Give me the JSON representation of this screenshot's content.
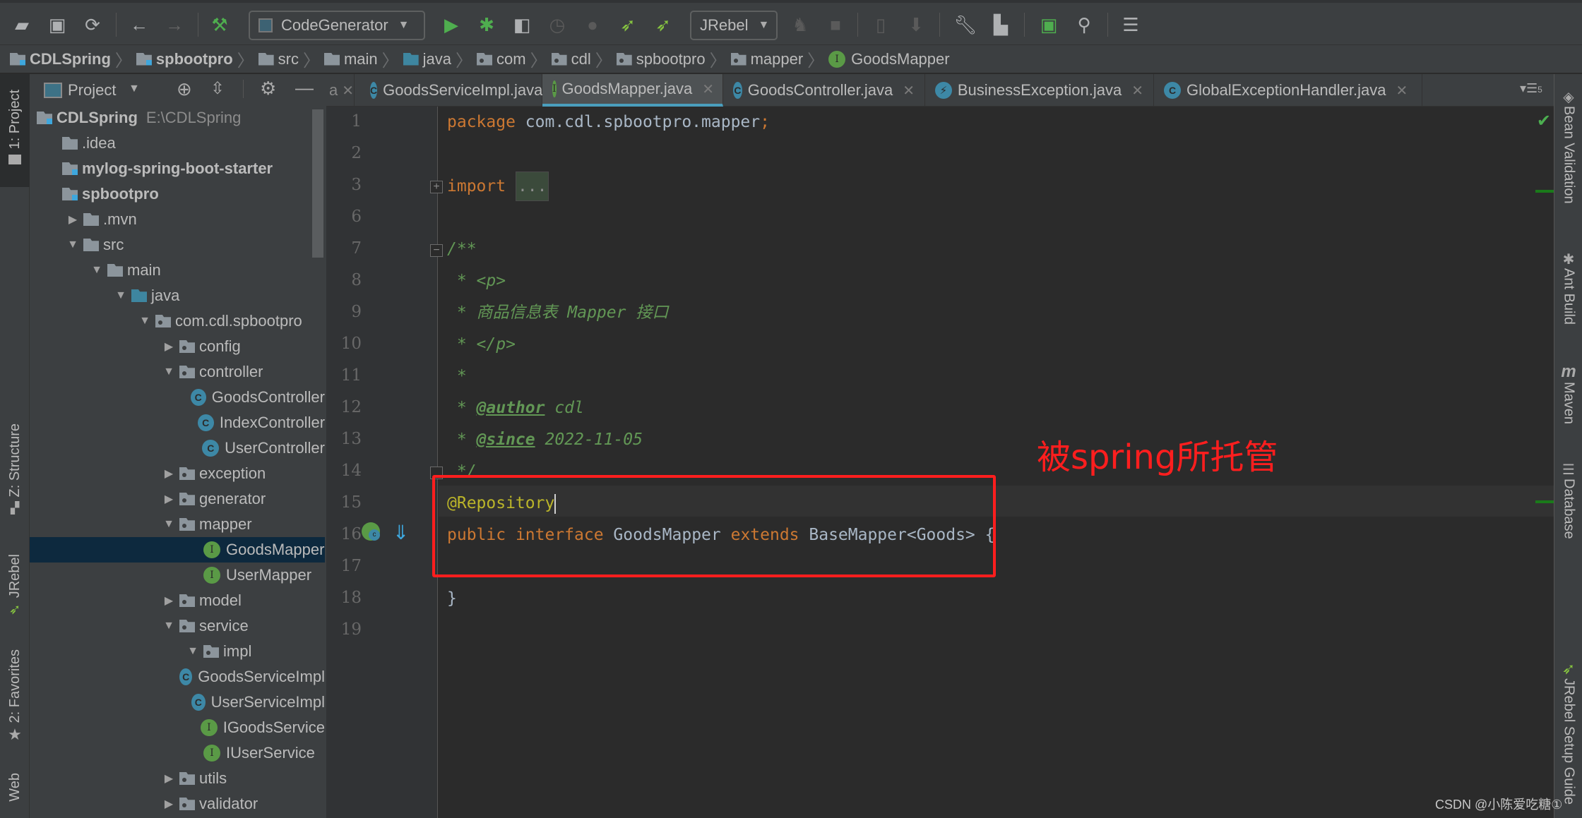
{
  "toolbar": {
    "run_config": "CodeGenerator",
    "jrebel_config": "JRebel",
    "icons": [
      "open-folder-icon",
      "save-icon",
      "sync-icon",
      "back-icon",
      "forward-icon",
      "build-hammer-icon",
      "run-icon",
      "debug-icon",
      "coverage-icon",
      "profile-icon",
      "jfr-icon",
      "jrebel-run-icon",
      "jrebel-debug-icon",
      "jrebel-stop-icon",
      "stop-icon",
      "android-device-icon",
      "sdk-download-icon",
      "settings-wrench-icon",
      "project-structure-icon",
      "run-anything-icon",
      "search-icon",
      "database-console-icon"
    ]
  },
  "breadcrumb": [
    {
      "label": "CDLSpring",
      "icon": "module",
      "bold": true
    },
    {
      "label": "spbootpro",
      "icon": "module",
      "bold": true
    },
    {
      "label": "src",
      "icon": "folder"
    },
    {
      "label": "main",
      "icon": "folder"
    },
    {
      "label": "java",
      "icon": "source-folder"
    },
    {
      "label": "com",
      "icon": "package"
    },
    {
      "label": "cdl",
      "icon": "package"
    },
    {
      "label": "spbootpro",
      "icon": "package"
    },
    {
      "label": "mapper",
      "icon": "package"
    },
    {
      "label": "GoodsMapper",
      "icon": "interface"
    }
  ],
  "left_strip": {
    "tabs": [
      "1: Project",
      "Z: Structure",
      "JRebel",
      "2: Favorites",
      "Web"
    ]
  },
  "project_panel": {
    "title": "Project",
    "tree": [
      {
        "label": "CDLSpring",
        "extra": "E:\\CDLSpring",
        "type": "module",
        "depth": 0,
        "bold": true,
        "arrow": ""
      },
      {
        "label": ".idea",
        "type": "folder",
        "depth": 1,
        "arrow": ""
      },
      {
        "label": "mylog-spring-boot-starter",
        "type": "module",
        "depth": 1,
        "bold": true,
        "arrow": ""
      },
      {
        "label": "spbootpro",
        "type": "module",
        "depth": 1,
        "bold": true,
        "arrow": ""
      },
      {
        "label": ".mvn",
        "type": "folder",
        "depth": 1,
        "arrow": "collapsed"
      },
      {
        "label": "src",
        "type": "folder",
        "depth": 1,
        "arrow": "expanded"
      },
      {
        "label": "main",
        "type": "folder",
        "depth": 2,
        "arrow": "expanded"
      },
      {
        "label": "java",
        "type": "source",
        "depth": 3,
        "arrow": "expanded"
      },
      {
        "label": "com.cdl.spbootpro",
        "type": "package",
        "depth": 4,
        "arrow": "expanded"
      },
      {
        "label": "config",
        "type": "package",
        "depth": 5,
        "arrow": "collapsed"
      },
      {
        "label": "controller",
        "type": "package",
        "depth": 5,
        "arrow": "expanded"
      },
      {
        "label": "GoodsController",
        "type": "class",
        "depth": 6,
        "arrow": ""
      },
      {
        "label": "IndexController",
        "type": "class",
        "depth": 6,
        "arrow": ""
      },
      {
        "label": "UserController",
        "type": "class",
        "depth": 6,
        "arrow": ""
      },
      {
        "label": "exception",
        "type": "package",
        "depth": 5,
        "arrow": "collapsed"
      },
      {
        "label": "generator",
        "type": "package",
        "depth": 5,
        "arrow": "collapsed"
      },
      {
        "label": "mapper",
        "type": "package",
        "depth": 5,
        "arrow": "expanded"
      },
      {
        "label": "GoodsMapper",
        "type": "interface",
        "depth": 6,
        "arrow": "",
        "selected": true
      },
      {
        "label": "UserMapper",
        "type": "interface",
        "depth": 6,
        "arrow": ""
      },
      {
        "label": "model",
        "type": "package",
        "depth": 5,
        "arrow": "collapsed"
      },
      {
        "label": "service",
        "type": "package",
        "depth": 5,
        "arrow": "expanded"
      },
      {
        "label": "impl",
        "type": "package",
        "depth": 6,
        "arrow": "expanded"
      },
      {
        "label": "GoodsServiceImpl",
        "type": "class",
        "depth": 7,
        "arrow": ""
      },
      {
        "label": "UserServiceImpl",
        "type": "class",
        "depth": 7,
        "arrow": ""
      },
      {
        "label": "IGoodsService",
        "type": "interface",
        "depth": 6,
        "arrow": ""
      },
      {
        "label": "IUserService",
        "type": "interface",
        "depth": 6,
        "arrow": ""
      },
      {
        "label": "utils",
        "type": "package",
        "depth": 5,
        "arrow": "collapsed"
      },
      {
        "label": "validator",
        "type": "package",
        "depth": 5,
        "arrow": "collapsed"
      }
    ]
  },
  "editor_tabs": [
    {
      "label": "a",
      "icon": "",
      "partial": true
    },
    {
      "label": "GoodsServiceImpl.java",
      "icon": "class"
    },
    {
      "label": "GoodsMapper.java",
      "icon": "interface",
      "active": true
    },
    {
      "label": "GoodsController.java",
      "icon": "class"
    },
    {
      "label": "BusinessException.java",
      "icon": "exception"
    },
    {
      "label": "GlobalExceptionHandler.java",
      "icon": "class"
    }
  ],
  "tab_overflow_count": "5",
  "code": {
    "line_numbers": [
      "1",
      "2",
      "3",
      "6",
      "7",
      "8",
      "9",
      "10",
      "11",
      "12",
      "13",
      "14",
      "15",
      "16",
      "17",
      "18",
      "19"
    ],
    "lines": [
      [
        {
          "t": "package ",
          "c": "kw"
        },
        {
          "t": "com.cdl.spbootpro.mapper",
          "c": "pl"
        },
        {
          "t": ";",
          "c": "kw"
        }
      ],
      [],
      [
        {
          "t": "import ",
          "c": "kw"
        },
        {
          "t": "...",
          "c": "fold"
        }
      ],
      [],
      [
        {
          "t": "/**",
          "c": "cm"
        }
      ],
      [
        {
          "t": " * <p>",
          "c": "cm"
        }
      ],
      [
        {
          "t": " * 商品信息表 Mapper 接口",
          "c": "cm"
        }
      ],
      [
        {
          "t": " * </p>",
          "c": "cm"
        }
      ],
      [
        {
          "t": " *",
          "c": "cm"
        }
      ],
      [
        {
          "t": " * ",
          "c": "cm"
        },
        {
          "t": "@author",
          "c": "cmtag"
        },
        {
          "t": " cdl",
          "c": "cm"
        }
      ],
      [
        {
          "t": " * ",
          "c": "cm"
        },
        {
          "t": "@since",
          "c": "cmtag"
        },
        {
          "t": " 2022-11-05",
          "c": "cm"
        }
      ],
      [
        {
          "t": " */",
          "c": "cm"
        }
      ],
      [
        {
          "t": "@Repository",
          "c": "ann"
        }
      ],
      [
        {
          "t": "public ",
          "c": "kw"
        },
        {
          "t": "interface ",
          "c": "kw"
        },
        {
          "t": "GoodsMapper ",
          "c": "pl"
        },
        {
          "t": "extends ",
          "c": "kw"
        },
        {
          "t": "BaseMapper<Goods> {",
          "c": "pl"
        }
      ],
      [],
      [
        {
          "t": "}",
          "c": "pl"
        }
      ],
      []
    ]
  },
  "annotation": {
    "label": "被spring所托管",
    "color": "#ff1e1e"
  },
  "right_strip": {
    "tabs": [
      "Bean Validation",
      "Ant Build",
      "Maven",
      "Database",
      "JRebel Setup Guide"
    ]
  },
  "watermark": "CSDN @小陈爱吃糖①"
}
